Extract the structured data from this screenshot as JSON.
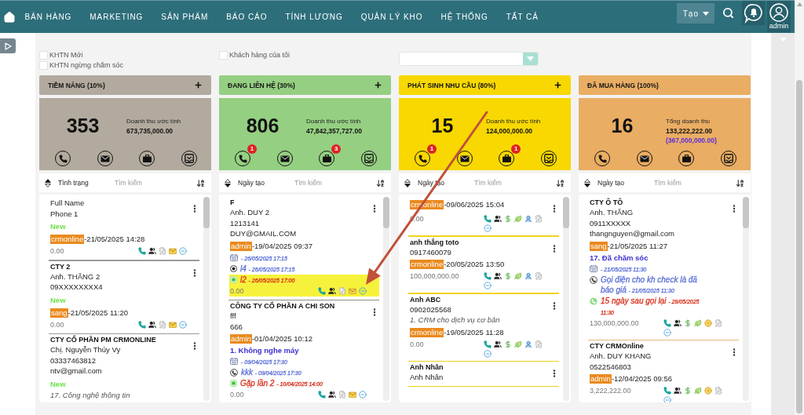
{
  "nav": {
    "menu": [
      "BÁN HÀNG",
      "MARKETING",
      "SẢN PHẨM",
      "BÁO CÁO",
      "TÍNH LƯƠNG",
      "QUẢN LÝ KHO",
      "HỆ THỐNG",
      "TẤT CẢ"
    ],
    "create_button": "Tạo",
    "user": "admin"
  },
  "filters": [
    {
      "items": [
        {
          "label": "KHTN Mới",
          "checked": false
        },
        {
          "label": "KHTN ngừng chăm sóc",
          "checked": false
        }
      ]
    },
    {
      "items": [
        {
          "label": "Khách hàng của tôi",
          "checked": false
        }
      ]
    }
  ],
  "columns": [
    {
      "title": "TIỀM NĂNG (10%)",
      "add_button": true,
      "color": "#b2aa9e",
      "divider": {
        "color": "#9a9a9a"
      },
      "summary": {
        "count": "353",
        "label": "Doanh thu ước tính",
        "amount": "673,735,000.00"
      },
      "sort": {
        "field": "Tình trạng",
        "ascending": true,
        "placeholder": "Tìm kiếm"
      },
      "cards": [
        {
          "lines": [
            {
              "kind": "text",
              "text": "Full Name"
            },
            {
              "kind": "text",
              "text": "Phone 1"
            },
            {
              "kind": "status",
              "text": "New",
              "color": "#6ee34b"
            },
            {
              "kind": "owner",
              "owner": "crmonline",
              "date": "-21/05/2025 14:28"
            }
          ],
          "amount": "0.00"
        },
        {
          "lines": [
            {
              "kind": "title",
              "text": "CTY 2"
            },
            {
              "kind": "text",
              "text": "Anh. THẮNG 2"
            },
            {
              "kind": "text",
              "text": "09XXXXXXXX4"
            },
            {
              "kind": "status",
              "text": "New",
              "color": "#6ee34b"
            },
            {
              "kind": "owner",
              "owner": "sang",
              "date": "-21/05/2025 11:20"
            }
          ],
          "amount": "0.00"
        },
        {
          "lines": [
            {
              "kind": "title",
              "text": "CTY CỔ PHẦN PM CRMONLINE"
            },
            {
              "kind": "text",
              "text": "Chị. Nguyễn Thúy Vy"
            },
            {
              "kind": "text",
              "text": "03337463812"
            },
            {
              "kind": "text",
              "text": "ntv@gmail.com"
            },
            {
              "kind": "status",
              "text": "New",
              "color": "#6ee34b"
            },
            {
              "kind": "note",
              "text": "17. Công nghệ thông tin"
            }
          ]
        }
      ]
    },
    {
      "title": "ĐANG LIÊN HỆ (30%)",
      "add_button": true,
      "color": "#95cf82",
      "divider": {
        "color": "#8c8c8c"
      },
      "summary": {
        "count": "806",
        "label": "Doanh thu ước tính",
        "amount": "47,842,357,727.00",
        "phone_badge": "1",
        "briefcase_badge": "3"
      },
      "sort": {
        "field": "Ngày tạo",
        "ascending": false,
        "placeholder": "Tìm kiếm"
      },
      "cards": [
        {
          "lines": [
            {
              "kind": "title",
              "text": "F"
            },
            {
              "kind": "text",
              "text": "Anh. DUY 2"
            },
            {
              "kind": "text",
              "text": "1213141"
            },
            {
              "kind": "text",
              "text": "DUY@GMAIL.COM"
            },
            {
              "kind": "owner",
              "owner": "admin",
              "date": "-19/04/2025 09:37"
            }
          ],
          "activities": [
            {
              "kind": "calendar",
              "date": "- 26/05/2025 17:15",
              "color": "#5b70d6"
            },
            {
              "kind": "record",
              "title": "l4",
              "date": "- 26/05/2025 17:15",
              "color": "#5b70d6"
            },
            {
              "kind": "meeting",
              "title": "l2",
              "date": "- 26/05/2025 17:00",
              "color": "#d8301c"
            }
          ],
          "amount": "0.00",
          "highlighted": true
        },
        {
          "lines": [
            {
              "kind": "title",
              "text": "CÔNG TY CỔ PHẦN A CHI SON"
            },
            {
              "kind": "text",
              "text": "fff"
            },
            {
              "kind": "text",
              "text": "666"
            },
            {
              "kind": "owner",
              "owner": "admin",
              "date": "-01/04/2025 10:12"
            },
            {
              "kind": "status",
              "text": "1. Không nghe máy",
              "color": "#3b2fd1"
            }
          ],
          "activities": [
            {
              "kind": "calendar",
              "date": "- 09/04/2025 17:30",
              "color": "#5b70d6"
            },
            {
              "kind": "call",
              "title": "kkk",
              "date": "- 09/04/2025 17:30",
              "color": "#5b70d6"
            },
            {
              "kind": "meeting",
              "title": "Gặp lần 2",
              "date": "- 10/04/2025 14:00",
              "color": "#d8301c"
            }
          ],
          "amount": "0.00"
        }
      ]
    },
    {
      "title": "PHÁT SINH NHU CẦU (80%)",
      "add_button": true,
      "color": "#f8d800",
      "divider": {
        "color": "#f2d21a"
      },
      "summary": {
        "count": "15",
        "label": "Doanh thu ước tính",
        "amount": "124,000,000.00",
        "phone_badge": "1",
        "briefcase_badge": "1"
      },
      "sort": {
        "field": "Ngày tạo",
        "ascending": false,
        "placeholder": "Tìm kiếm"
      },
      "cards": [
        {
          "lines": [
            {
              "kind": "owner",
              "owner": "crmonline",
              "date": "-09/06/2025 15:04"
            }
          ],
          "amount": "0.00"
        },
        {
          "lines": [
            {
              "kind": "title",
              "text": "anh thắng toto"
            },
            {
              "kind": "text",
              "text": "0917460079"
            },
            {
              "kind": "owner",
              "owner": "crmonline",
              "date": "-20/05/2025 13:50"
            }
          ],
          "amount": "100,000,000.00"
        },
        {
          "lines": [
            {
              "kind": "title",
              "text": "Anh ABC"
            },
            {
              "kind": "text",
              "text": "0902025568"
            },
            {
              "kind": "note",
              "text": "1. CRM cho dịch vụ cơ bản"
            },
            {
              "kind": "owner",
              "owner": "crmonline",
              "date": "-19/05/2025 11:28"
            }
          ],
          "amount": "0.00"
        },
        {
          "lines": [
            {
              "kind": "title",
              "text": "Anh Nhân"
            },
            {
              "kind": "text",
              "text": "Anh Nhân"
            }
          ]
        }
      ]
    },
    {
      "title": "ĐÃ MUA HÀNG (100%)",
      "add_button": false,
      "color": "#e9ad63",
      "divider": {
        "color": "#e3b57a"
      },
      "summary": {
        "count": "16",
        "label": "Tổng doanh thu",
        "amount": "133,222,222.00",
        "secondary_amount": "(367,000,000.00)"
      },
      "sort": {
        "field": "Ngày tạo",
        "ascending": false,
        "placeholder": "Tìm kiếm"
      },
      "cards": [
        {
          "lines": [
            {
              "kind": "title",
              "text": "CTY Ô TÔ"
            },
            {
              "kind": "text",
              "text": "Anh. THẮNG"
            },
            {
              "kind": "text",
              "text": "0911XXXXX"
            },
            {
              "kind": "text",
              "text": "thangnguyen@gmail.com"
            },
            {
              "kind": "owner",
              "owner": "sang",
              "date": "-21/05/2025 11:27"
            },
            {
              "kind": "status",
              "text": "17. Đã chăm sóc",
              "color": "#3b2fd1"
            }
          ],
          "activities": [
            {
              "kind": "calendar",
              "date": "- 21/05/2025 11:30",
              "color": "#5b70d6"
            },
            {
              "kind": "call",
              "title": "Gọi điện cho kh check là đã báo giá",
              "date": "- 21/05/2025 11:30",
              "color": "#5b70d6"
            },
            {
              "kind": "followup",
              "title": "15 ngày sau gọi lại",
              "date": "- 29/05/2025 11:30",
              "color": "#d8301c"
            }
          ],
          "amount": "130,000,000.00"
        },
        {
          "lines": [
            {
              "kind": "title",
              "text": "CTY CRMOnline"
            },
            {
              "kind": "text",
              "text": "Anh. DUY KHANG"
            },
            {
              "kind": "text",
              "text": "0522546803"
            },
            {
              "kind": "owner",
              "owner": "admin",
              "date": "-12/04/2025 09:56"
            }
          ],
          "amount": "3,222,222.00"
        }
      ]
    }
  ]
}
